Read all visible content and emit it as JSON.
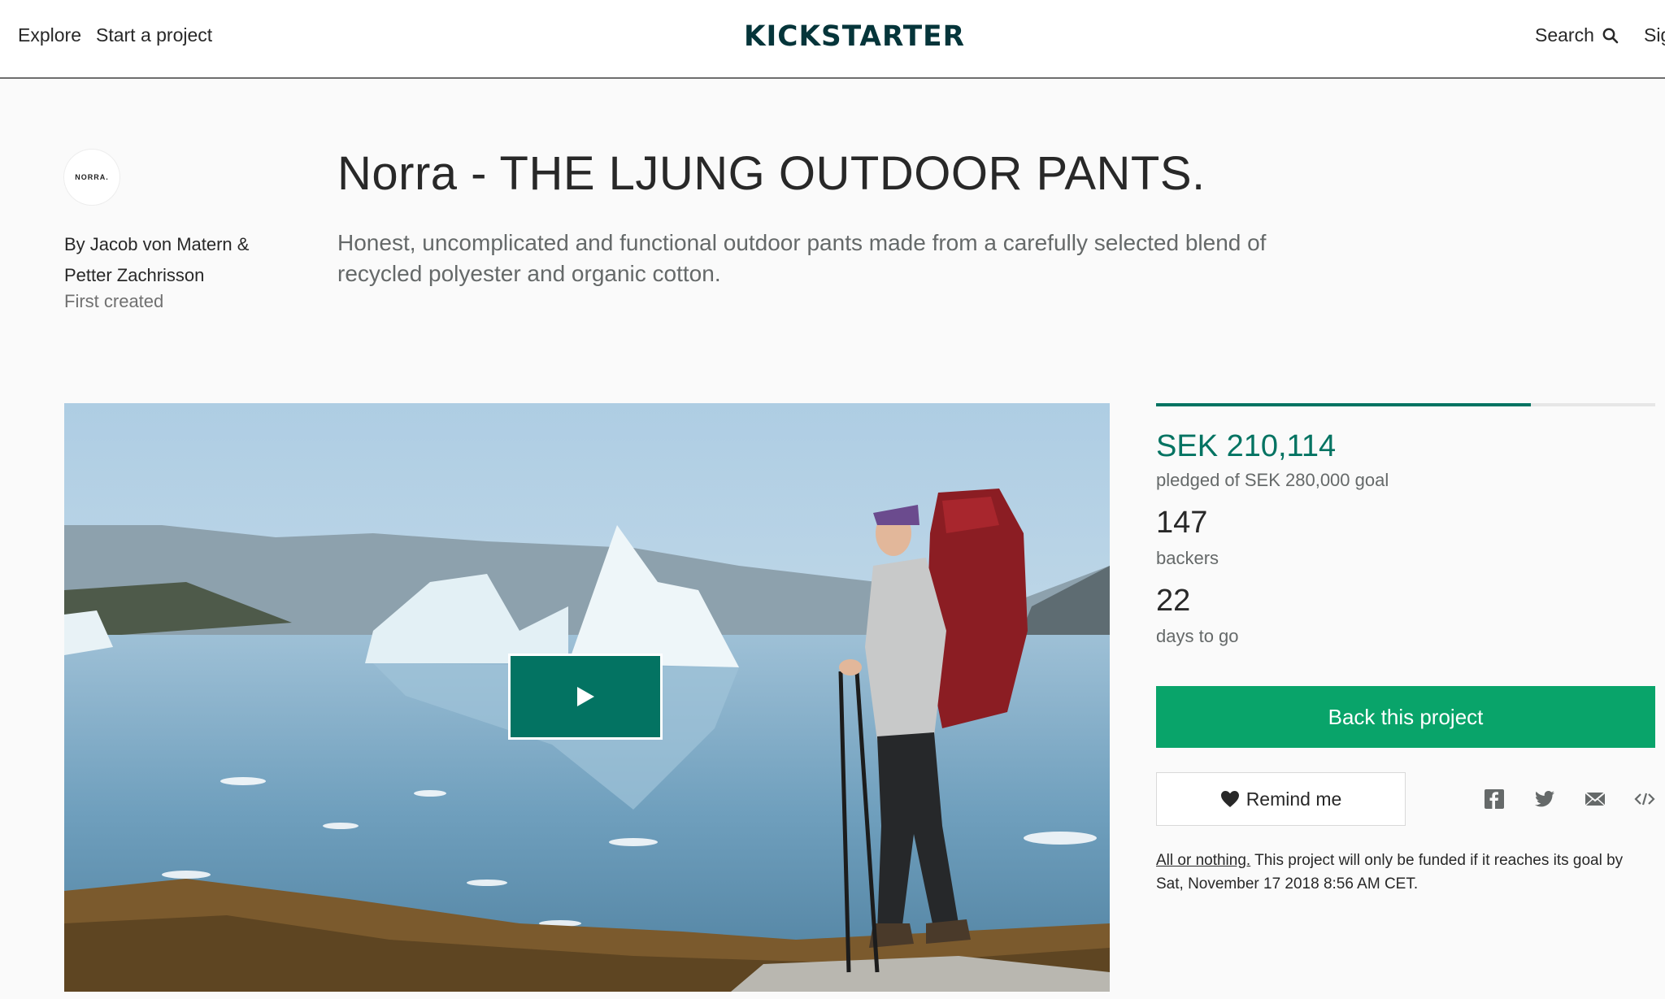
{
  "header": {
    "nav": [
      "Explore",
      "Start a project"
    ],
    "logo_text": "KICKSTARTER",
    "search_label": "Search",
    "signin_label": "Sig"
  },
  "creator": {
    "avatar_text": "NORRA.",
    "byline": "By Jacob von Matern & Petter Zachrisson",
    "first_created": "First created"
  },
  "project": {
    "title": "Norra - THE LJUNG OUTDOOR PANTS.",
    "blurb": "Honest, uncomplicated and functional outdoor pants made from a carefully selected blend of recycled polyester and organic cotton."
  },
  "stats": {
    "funded_fraction": 0.7504,
    "pledged": "SEK 210,114",
    "pledged_label": "pledged of SEK 280,000 goal",
    "backers": "147",
    "backers_label": "backers",
    "days": "22",
    "days_label": "days to go"
  },
  "actions": {
    "back_label": "Back this project",
    "remind_label": "Remind me",
    "share_icons": [
      "facebook-icon",
      "twitter-icon",
      "email-icon",
      "embed-icon"
    ]
  },
  "funding_note": {
    "link": "All or nothing.",
    "text": " This project will only be funded if it reaches its goal by Sat, November 17 2018 8:56 AM CET."
  },
  "colors": {
    "brand_green": "#037362",
    "button_green": "#09a46a",
    "logo_color": "#05353a"
  }
}
